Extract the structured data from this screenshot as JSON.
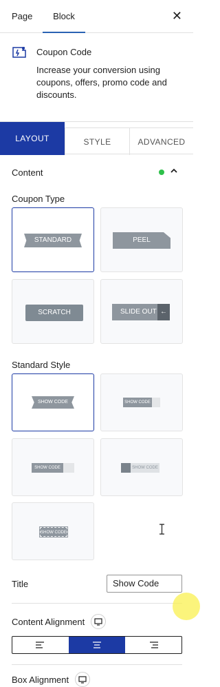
{
  "top_tabs": {
    "page": "Page",
    "block": "Block",
    "close": "✕"
  },
  "block_card": {
    "title": "Coupon Code",
    "description": "Increase your conversion using coupons, offers, promo code and discounts."
  },
  "sub_tabs": {
    "layout": "LAYOUT",
    "style": "STYLE",
    "advanced": "ADVANCED"
  },
  "content_section": {
    "title": "Content",
    "status_color": "#2ec04a"
  },
  "coupon_type": {
    "label": "Coupon Type",
    "options": [
      "STANDARD",
      "PEEL",
      "SCRATCH",
      "SLIDE OUT"
    ],
    "selected": "STANDARD"
  },
  "standard_style": {
    "label": "Standard Style",
    "option_label": "SHOW CODE",
    "selected_index": 0,
    "count": 5
  },
  "title_field": {
    "label": "Title",
    "value": "Show Code"
  },
  "content_alignment": {
    "label": "Content Alignment",
    "selected": "center"
  },
  "box_alignment": {
    "label": "Box Alignment"
  },
  "accent_color": "#1c3aa4"
}
